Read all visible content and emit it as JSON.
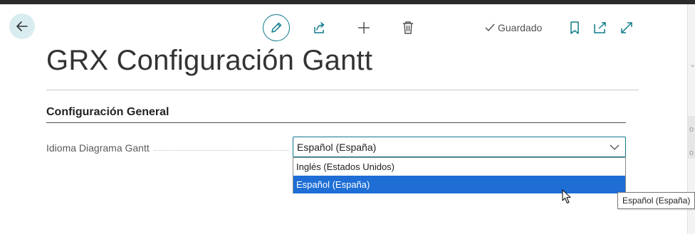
{
  "header": {
    "status_label": "Guardado"
  },
  "toolbar": {
    "icons": [
      "back-arrow-icon",
      "pencil-icon",
      "share-icon",
      "plus-icon",
      "trash-icon",
      "check-icon",
      "bookmark-icon",
      "popout-icon",
      "expand-icon"
    ]
  },
  "page": {
    "title": "GRX Configuración Gantt"
  },
  "section": {
    "title": "Configuración General"
  },
  "field": {
    "label": "Idioma Diagrama Gantt",
    "value": "Español (España)",
    "options": [
      {
        "label": "Inglés (Estados Unidos)",
        "selected": false
      },
      {
        "label": "Español (España)",
        "selected": true
      }
    ]
  },
  "tooltip": {
    "text": "Español (España)"
  },
  "colors": {
    "accent": "#0f7b8a",
    "back_button_bg": "#d9ecf0",
    "selected_option_bg": "#1e6ed6"
  }
}
